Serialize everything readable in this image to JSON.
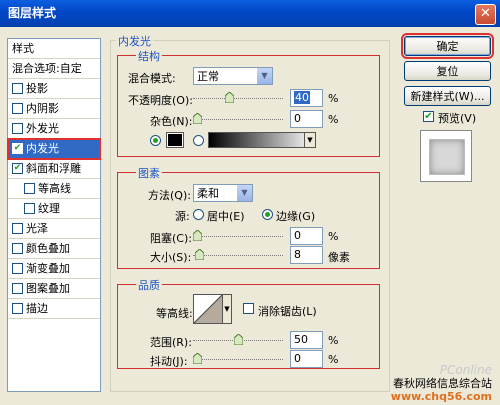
{
  "window": {
    "title": "图层样式"
  },
  "styles_panel": {
    "items": [
      {
        "label": "样式",
        "type": "plain"
      },
      {
        "label": "混合选项:自定",
        "type": "plain"
      },
      {
        "label": "投影",
        "checked": false
      },
      {
        "label": "内阴影",
        "checked": false
      },
      {
        "label": "外发光",
        "checked": false
      },
      {
        "label": "内发光",
        "checked": true,
        "selected": true
      },
      {
        "label": "斜面和浮雕",
        "checked": true
      },
      {
        "label": "等高线",
        "checked": false,
        "sub": true
      },
      {
        "label": "纹理",
        "checked": false,
        "sub": true
      },
      {
        "label": "光泽",
        "checked": false
      },
      {
        "label": "颜色叠加",
        "checked": false
      },
      {
        "label": "渐变叠加",
        "checked": false
      },
      {
        "label": "图案叠加",
        "checked": false
      },
      {
        "label": "描边",
        "checked": false
      }
    ]
  },
  "inner_glow": {
    "title": "内发光",
    "structure": {
      "title": "结构",
      "blend_mode_label": "混合模式:",
      "blend_mode_value": "正常",
      "opacity_label": "不透明度(O):",
      "opacity_value": "40",
      "opacity_fraction": 0.4,
      "noise_label": "杂色(N):",
      "noise_value": "0",
      "noise_fraction": 0,
      "percent": "%",
      "glow_color": "#000000",
      "color_mode": "solid"
    },
    "elements": {
      "title": "图素",
      "method_label": "方法(Q):",
      "method_value": "柔和",
      "source_label": "源:",
      "source_center": "居中(E)",
      "source_edge": "边缘(G)",
      "source_selected": "edge",
      "choke_label": "阻塞(C):",
      "choke_value": "0",
      "choke_fraction": 0,
      "size_label": "大小(S):",
      "size_value": "8",
      "size_fraction": 0.03,
      "percent": "%",
      "px_unit": "像素"
    },
    "quality": {
      "title": "品质",
      "contour_label": "等高线:",
      "anti_alias_label": "消除锯齿(L)",
      "anti_alias_checked": false,
      "range_label": "范围(R):",
      "range_value": "50",
      "range_fraction": 0.5,
      "jitter_label": "抖动(J):",
      "jitter_value": "0",
      "jitter_fraction": 0,
      "percent": "%"
    }
  },
  "buttons": {
    "ok": "确定",
    "reset": "复位",
    "new_style": "新建样式(W)...",
    "preview_label": "预览(V)",
    "preview_checked": true
  },
  "watermark": {
    "logo": "PConline",
    "site_name": "春秋网络信息综合站",
    "url": "www.chq56.com"
  }
}
